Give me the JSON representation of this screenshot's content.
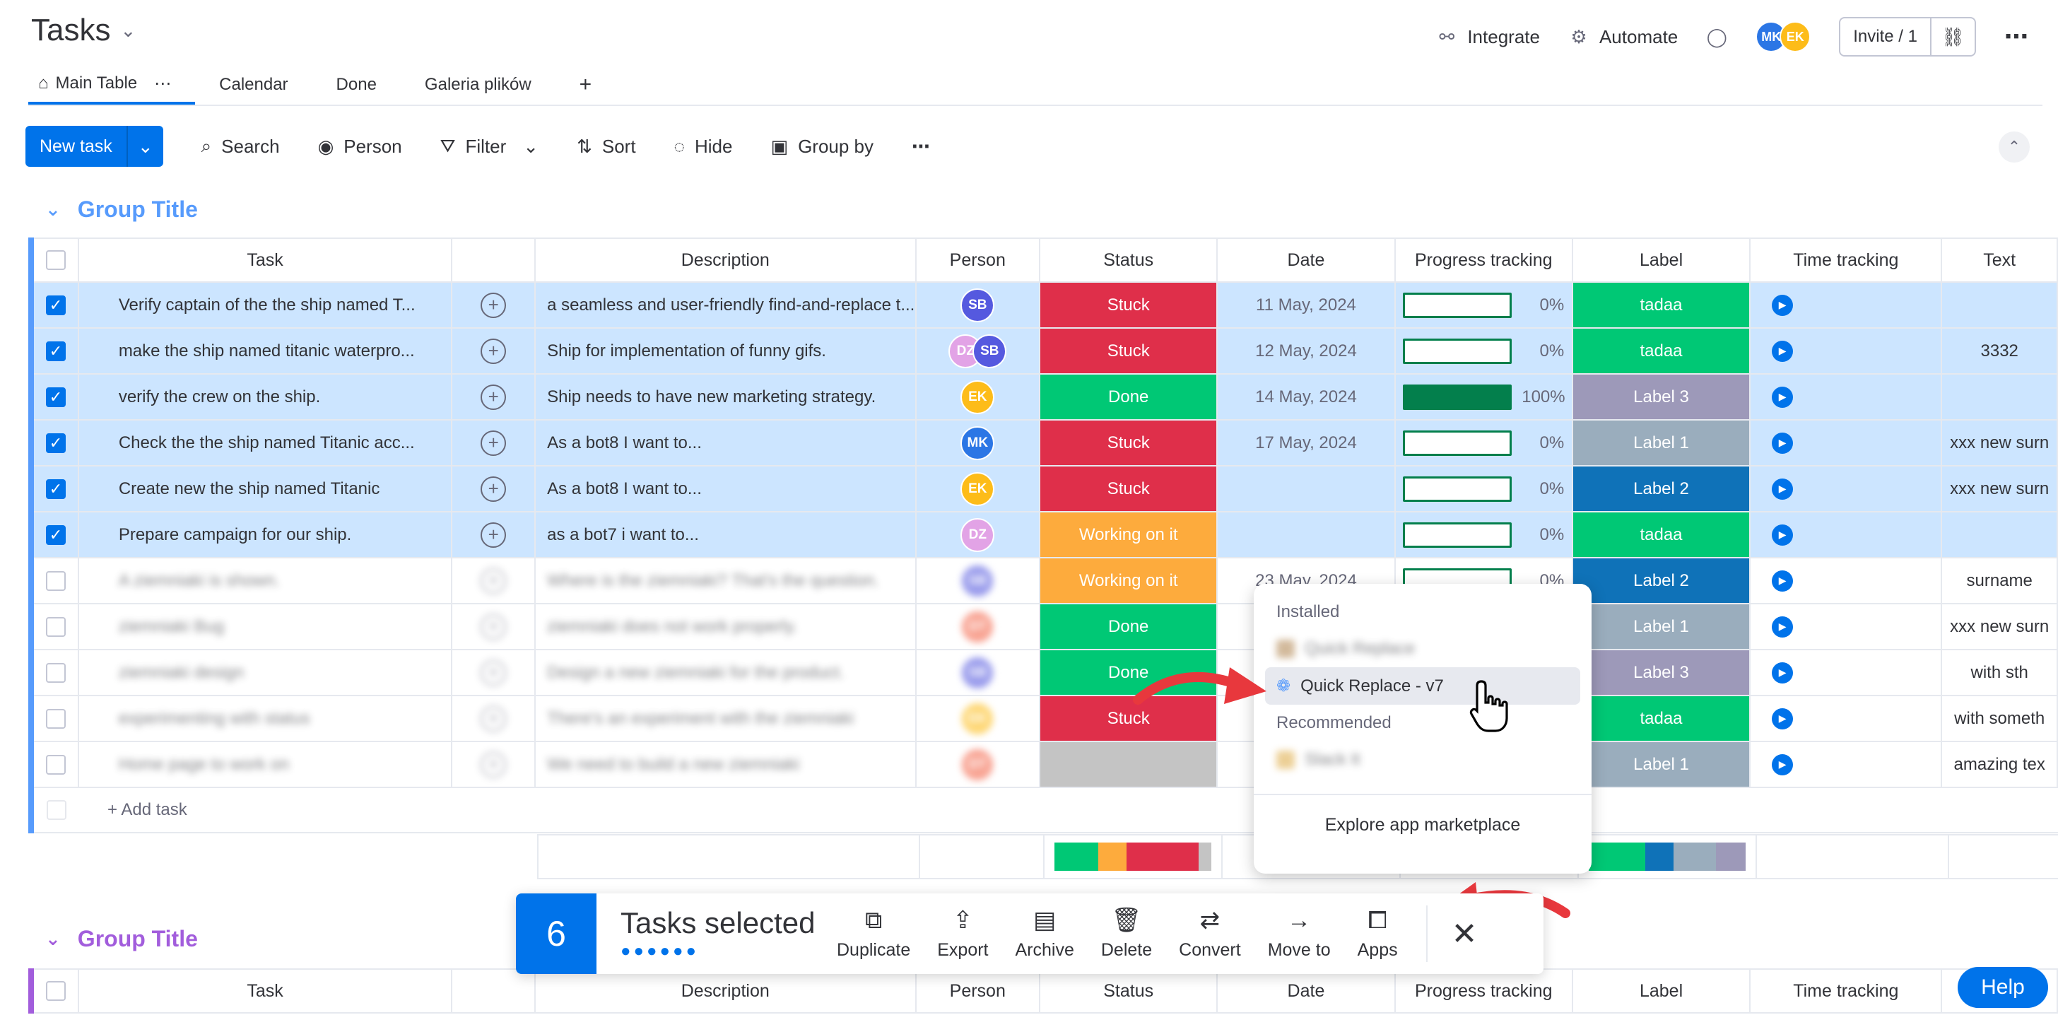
{
  "board": {
    "title": "Tasks"
  },
  "header": {
    "integrate": "Integrate",
    "automate": "Automate",
    "avatars": [
      {
        "initials": "MK",
        "color": "#2b76e5"
      },
      {
        "initials": "EK",
        "color": "#fdbc19"
      }
    ],
    "invite": "Invite / 1"
  },
  "tabs": [
    {
      "label": "Main Table"
    },
    {
      "label": "Calendar"
    },
    {
      "label": "Done"
    },
    {
      "label": "Galeria plików"
    }
  ],
  "tab_add": "+",
  "toolbar": {
    "new_task": "New task",
    "search": "Search",
    "person": "Person",
    "filter": "Filter",
    "sort": "Sort",
    "hide": "Hide",
    "group_by": "Group by"
  },
  "groups": [
    {
      "title": "Group Title",
      "color": "#579bfc"
    },
    {
      "title": "Group Title",
      "color": "#a25ddc"
    }
  ],
  "columns": {
    "task": "Task",
    "description": "Description",
    "person": "Person",
    "status": "Status",
    "date": "Date",
    "progress": "Progress tracking",
    "label": "Label",
    "time": "Time tracking",
    "text": "Text"
  },
  "rows": [
    {
      "task": "Verify captain of the the ship named T...",
      "desc": "a seamless and user-friendly find-and-replace t...",
      "persons": [
        {
          "i": "SB",
          "c": "#5559df"
        }
      ],
      "status": "Stuck",
      "status_color": "#df2f4a",
      "date": "11 May, 2024",
      "progress": 0,
      "progress_label": "0%",
      "label": "tadaa",
      "label_color": "#00c875",
      "text": "",
      "selected": true
    },
    {
      "task": "make the ship named titanic waterpro...",
      "desc": "Ship for implementation of funny gifs.",
      "persons": [
        {
          "i": "DZ",
          "c": "#e2a3e6"
        },
        {
          "i": "SB",
          "c": "#5559df"
        }
      ],
      "status": "Stuck",
      "status_color": "#df2f4a",
      "date": "12 May, 2024",
      "progress": 0,
      "progress_label": "0%",
      "label": "tadaa",
      "label_color": "#00c875",
      "text": "3332",
      "selected": true
    },
    {
      "task": "verify the crew on the ship.",
      "desc": "Ship needs to have new marketing strategy.",
      "persons": [
        {
          "i": "EK",
          "c": "#fdbc19"
        }
      ],
      "status": "Done",
      "status_color": "#00c875",
      "date": "14 May, 2024",
      "progress": 100,
      "progress_label": "100%",
      "label": "Label 3",
      "label_color": "#9d99b9",
      "text": "",
      "selected": true
    },
    {
      "task": "Check the the ship named Titanic acc...",
      "desc": "As a bot8 I want to...",
      "persons": [
        {
          "i": "MK",
          "c": "#2b76e5"
        }
      ],
      "status": "Stuck",
      "status_color": "#df2f4a",
      "date": "17 May, 2024",
      "progress": 0,
      "progress_label": "0%",
      "label": "Label 1",
      "label_color": "#9aadbd",
      "text": "xxx new surn",
      "selected": true
    },
    {
      "task": "Create new the ship named Titanic",
      "desc": "As a bot8 I want to...",
      "persons": [
        {
          "i": "EK",
          "c": "#fdbc19"
        }
      ],
      "status": "Stuck",
      "status_color": "#df2f4a",
      "date": "",
      "progress": 0,
      "progress_label": "0%",
      "label": "Label 2",
      "label_color": "#0f72b8",
      "text": "xxx new surn",
      "selected": true
    },
    {
      "task": "Prepare campaign for our ship.",
      "desc": "as a bot7 i want to...",
      "persons": [
        {
          "i": "DZ",
          "c": "#e2a3e6"
        }
      ],
      "status": "Working on it",
      "status_color": "#fdab3d",
      "date": "",
      "progress": 0,
      "progress_label": "0%",
      "label": "tadaa",
      "label_color": "#00c875",
      "text": "",
      "selected": true
    },
    {
      "task": "A ziemniaki is shown.",
      "desc": "Where is the ziemniaki? That's the question.",
      "persons": [
        {
          "i": "SB",
          "c": "#5559df"
        }
      ],
      "status": "Working on it",
      "status_color": "#fdab3d",
      "date": "23 May, 2024",
      "progress": 0,
      "progress_label": "0%",
      "label": "Label 2",
      "label_color": "#0f72b8",
      "text": "surname",
      "selected": false
    },
    {
      "task": "ziemniaki Bug",
      "desc": "ziemniaki does not work properly.",
      "persons": [
        {
          "i": "DT",
          "c": "#f4664a"
        }
      ],
      "status": "Done",
      "status_color": "#00c875",
      "date": "",
      "progress": 0,
      "progress_label": "",
      "label": "Label 1",
      "label_color": "#9aadbd",
      "text": "xxx new surn",
      "selected": false
    },
    {
      "task": "ziemniaki design",
      "desc": "Design a new ziemniaki for the product.",
      "persons": [
        {
          "i": "SB",
          "c": "#5559df"
        }
      ],
      "status": "Done",
      "status_color": "#00c875",
      "date": "",
      "progress": 0,
      "progress_label": "",
      "label": "Label 3",
      "label_color": "#9d99b9",
      "text": "with sth",
      "selected": false
    },
    {
      "task": "experimenting with status",
      "desc": "There's an experiment with the ziemniaki",
      "persons": [
        {
          "i": "EK",
          "c": "#fdbc19"
        }
      ],
      "status": "Stuck",
      "status_color": "#df2f4a",
      "date": "",
      "progress": 0,
      "progress_label": "",
      "label": "tadaa",
      "label_color": "#00c875",
      "text": "with someth",
      "selected": false
    },
    {
      "task": "Home page to work on",
      "desc": "We need to build a new ziemniaki",
      "persons": [
        {
          "i": "DT",
          "c": "#f4664a"
        }
      ],
      "status": "",
      "status_color": "#c4c4c4",
      "date": "",
      "progress": 0,
      "progress_label": "",
      "label": "Label 1",
      "label_color": "#9aadbd",
      "text": "amazing tex",
      "selected": false
    }
  ],
  "add_task": "+ Add task",
  "dropdown": {
    "installed": "Installed",
    "app1": "Quick Replace",
    "app2": "Quick Replace - v7",
    "recommended": "Recommended",
    "app3": "Slack It",
    "explore": "Explore app marketplace"
  },
  "selection": {
    "count": "6",
    "label": "Tasks selected",
    "dots": "●●●●●●",
    "actions": [
      {
        "label": "Duplicate"
      },
      {
        "label": "Export"
      },
      {
        "label": "Archive"
      },
      {
        "label": "Delete"
      },
      {
        "label": "Convert"
      },
      {
        "label": "Move to"
      },
      {
        "label": "Apps"
      }
    ]
  },
  "help": "Help"
}
